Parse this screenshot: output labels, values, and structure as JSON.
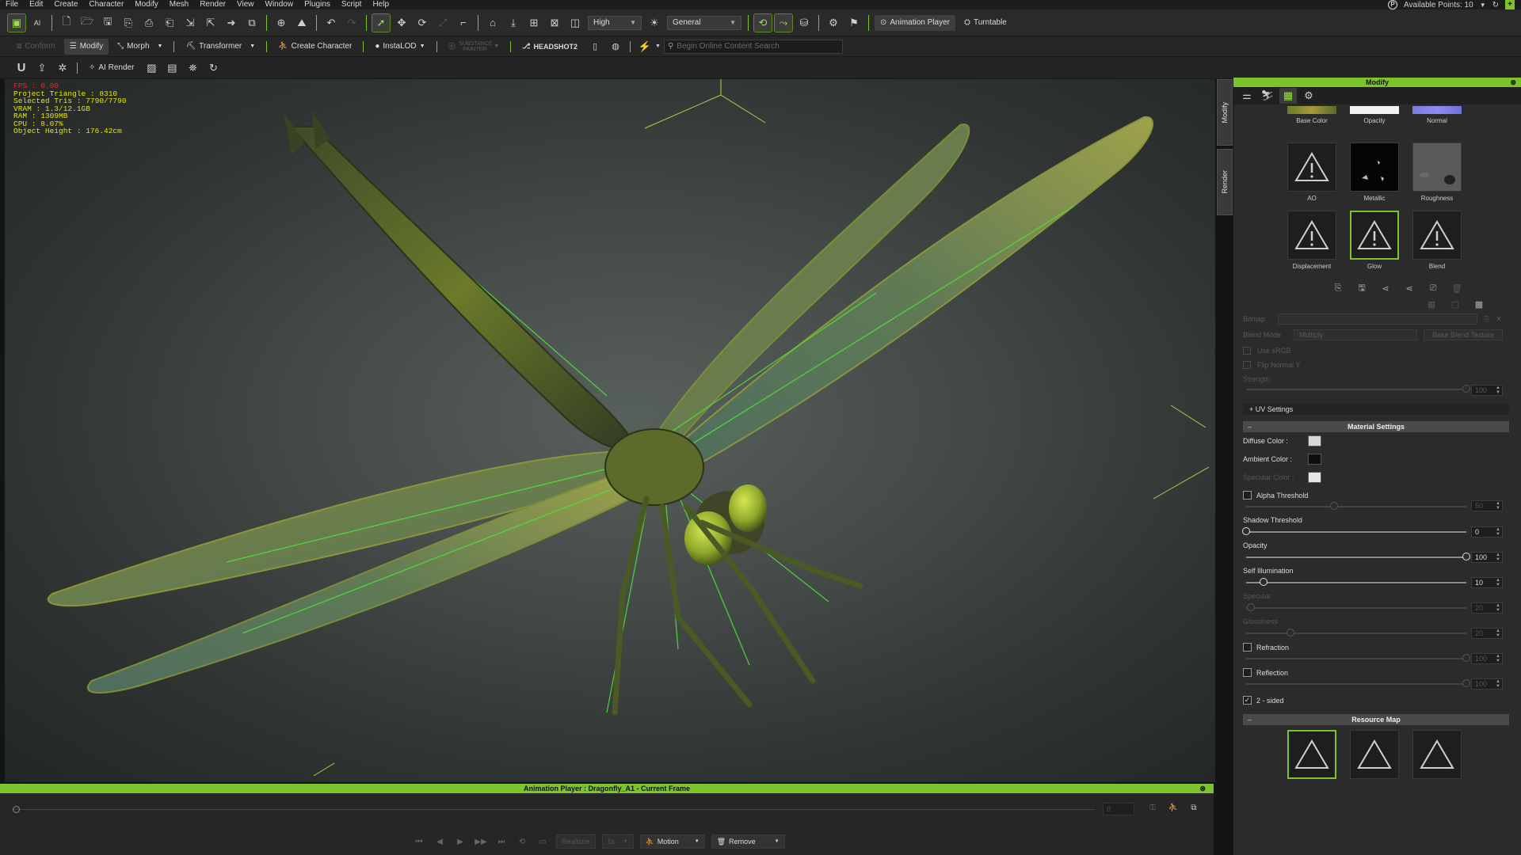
{
  "menubar": {
    "items": [
      "File",
      "Edit",
      "Create",
      "Character",
      "Modify",
      "Mesh",
      "Render",
      "View",
      "Window",
      "Plugins",
      "Script",
      "Help"
    ],
    "available_points": "Available Points: 10"
  },
  "toolbar1": {
    "quality": "High",
    "preset": "General",
    "animation_player": "Animation Player",
    "turntable": "Turntable"
  },
  "toolbar2": {
    "conform": "Conform",
    "modify": "Modify",
    "morph": "Morph",
    "transformer": "Transformer",
    "create_character": "Create Character",
    "instalod": "InstaLOD",
    "substance": "SUBSTANCE PAINTER",
    "headshot": "HEADSHOT2",
    "search_placeholder": "Begin Online Content Search"
  },
  "toolbar3": {
    "ai_render": "AI Render"
  },
  "viewport": {
    "fps": "FPS : 0.00",
    "stats": [
      "Project Triangle : 8310",
      "Selected Tris : 7790/7790",
      "VRAM : 1.3/12.1GB",
      "RAM : 1309MB",
      "CPU : 8.07%",
      "Object Height : 176.42cm"
    ]
  },
  "side_tabs": [
    "Modify",
    "Render"
  ],
  "panel": {
    "title": "Modify",
    "textures_row0": [
      "Base Color",
      "Opacity",
      "Normal"
    ],
    "textures_row1": [
      "AO",
      "Metallic",
      "Roughness"
    ],
    "textures_row2": [
      "Displacement",
      "Glow",
      "Blend"
    ],
    "bitmap_label": "Bitmap",
    "blend_mode_label": "Blend Mode",
    "blend_mode_value": "Multiply",
    "bake_blend": "Bake Blend Texture",
    "use_srgb": "Use sRGB",
    "flip_normal": "Flip Normal Y",
    "strength_label": "Strength",
    "strength_value": "100",
    "uv_settings": "UV Settings",
    "material_settings": "Material Settings",
    "diffuse_color": "Diffuse Color :",
    "ambient_color": "Ambient Color :",
    "specular_color": "Specular Color :",
    "alpha_threshold": "Alpha Threshold",
    "alpha_value": "50",
    "shadow_threshold": "Shadow Threshold",
    "shadow_value": "0",
    "opacity_label": "Opacity",
    "opacity_value": "100",
    "self_illum_label": "Self Illumination",
    "self_illum_value": "10",
    "specular_label": "Specular",
    "specular_value": "20",
    "glossiness_label": "Glossiness",
    "glossiness_value": "20",
    "refraction": "Refraction",
    "refraction_value": "100",
    "reflection": "Reflection",
    "reflection_value": "100",
    "two_sided": "2 - sided",
    "resource_map": "Resource Map",
    "colors": {
      "diffuse": "#d8d8d8",
      "ambient": "#0e0e0e",
      "specular": "#e6e6e6"
    },
    "sliders": {
      "shadow": 0.0,
      "opacity": 1.0,
      "self_illum": 0.08,
      "specular": 0.02,
      "glossiness": 0.2,
      "alpha": 0.4,
      "refraction": 1.0,
      "reflection": 1.0,
      "strength": 1.0
    },
    "states": {
      "alpha_threshold": false,
      "refraction": false,
      "reflection": false,
      "two_sided": true
    }
  },
  "animation_player": {
    "title": "Animation Player : Dragonfly_A1 - Current Frame",
    "frame": "0",
    "realtime": "Realtime",
    "speed": "1x",
    "motion": "Motion",
    "remove": "Remove"
  },
  "accent": "#7cc42b"
}
